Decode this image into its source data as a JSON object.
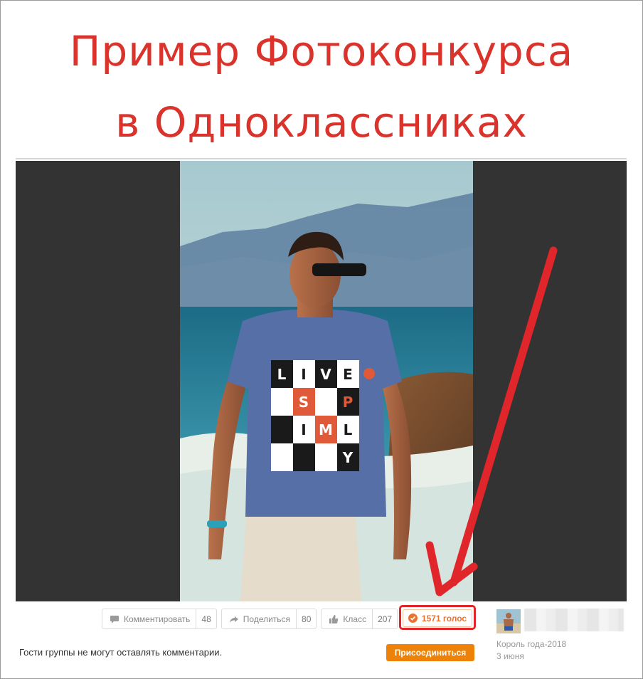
{
  "headline": {
    "line1": "Пример Фотоконкурса",
    "line2": "в Одноклассниках"
  },
  "photo": {
    "shirt_rows": [
      "LIVE",
      "S  P",
      "IML",
      "Y"
    ]
  },
  "actions": {
    "comment": {
      "label": "Комментировать",
      "count": "48",
      "icon": "speech-bubble-icon"
    },
    "share": {
      "label": "Поделиться",
      "count": "80",
      "icon": "share-arrow-icon"
    },
    "like": {
      "label": "Класс",
      "count": "207",
      "icon": "thumbs-up-icon"
    },
    "vote": {
      "label": "1571 голос",
      "icon": "check-circle-icon"
    }
  },
  "footer": {
    "guests_notice": "Гости группы не могут оставлять комментарии.",
    "join_label": "Присоединиться"
  },
  "author": {
    "album": "Король года-2018",
    "date": "3 июня"
  },
  "colors": {
    "headline": "#d9332b",
    "accent_orange": "#ee8208",
    "vote_text": "#eb722e",
    "highlight_red": "#e0262a",
    "viewer_bg": "#333333"
  }
}
